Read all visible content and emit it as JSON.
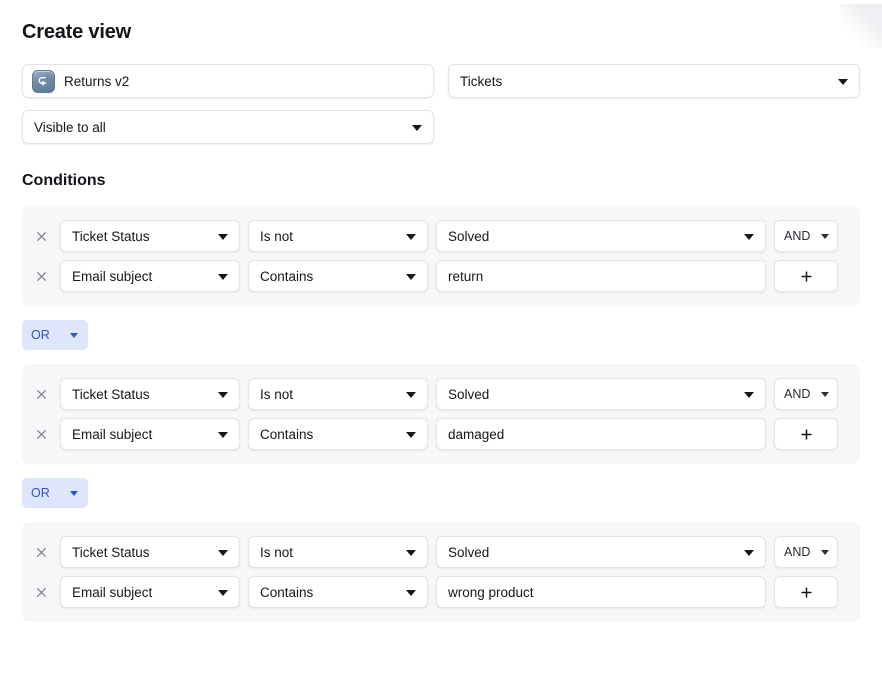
{
  "page": {
    "title": "Create view",
    "conditions_heading": "Conditions"
  },
  "view_settings": {
    "name_value": "Returns v2",
    "name_placeholder": "View name",
    "name_icon": "return-arrow-icon",
    "type_value": "Tickets",
    "visibility_value": "Visible to all"
  },
  "icons": {
    "remove": "close-icon",
    "add": "plus-icon",
    "caret": "chevron-down-icon"
  },
  "colors": {
    "chip_bg": "#dde6fb",
    "chip_text": "#2f55c8",
    "group_bg": "#f7f7f9",
    "field_border": "#e3e3e8",
    "page_bg": "#ffffff"
  },
  "condition_groups": [
    {
      "rows": [
        {
          "attribute": "Ticket Status",
          "operator": "Is not",
          "value": "Solved",
          "value_type": "select",
          "logic": "AND",
          "trailing": "logic"
        },
        {
          "attribute": "Email subject",
          "operator": "Contains",
          "value": "return",
          "value_type": "text",
          "logic": "",
          "trailing": "add"
        }
      ]
    },
    {
      "rows": [
        {
          "attribute": "Ticket Status",
          "operator": "Is not",
          "value": "Solved",
          "value_type": "select",
          "logic": "AND",
          "trailing": "logic"
        },
        {
          "attribute": "Email subject",
          "operator": "Contains",
          "value": "damaged",
          "value_type": "text",
          "logic": "",
          "trailing": "add"
        }
      ]
    },
    {
      "rows": [
        {
          "attribute": "Ticket Status",
          "operator": "Is not",
          "value": "Solved",
          "value_type": "select",
          "logic": "AND",
          "trailing": "logic"
        },
        {
          "attribute": "Email subject",
          "operator": "Contains",
          "value": "wrong product",
          "value_type": "text",
          "logic": "",
          "trailing": "add"
        }
      ]
    }
  ],
  "group_separators": [
    {
      "label": "OR"
    },
    {
      "label": "OR"
    }
  ]
}
